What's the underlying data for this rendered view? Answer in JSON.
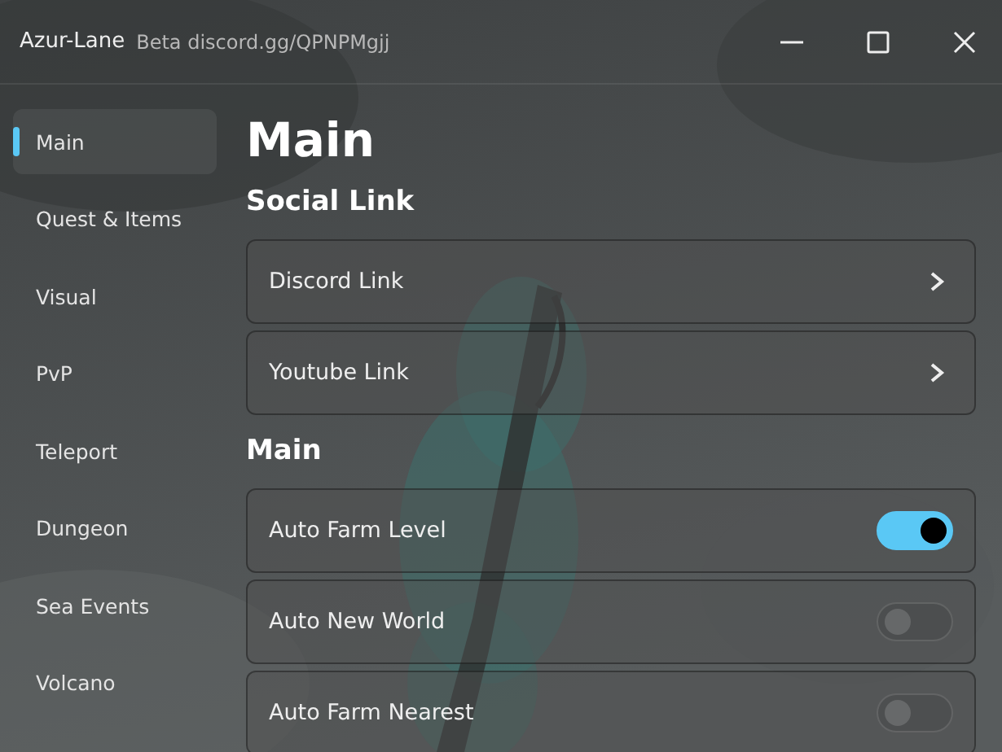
{
  "window": {
    "title": "Azur-Lane",
    "subtitle": "Beta discord.gg/QPNPMgjj"
  },
  "sidebar": {
    "items": [
      {
        "label": "Main",
        "selected": true
      },
      {
        "label": "Quest & Items",
        "selected": false
      },
      {
        "label": "Visual",
        "selected": false
      },
      {
        "label": "PvP",
        "selected": false
      },
      {
        "label": "Teleport",
        "selected": false
      },
      {
        "label": "Dungeon",
        "selected": false
      },
      {
        "label": "Sea Events",
        "selected": false
      },
      {
        "label": "Volcano",
        "selected": false
      }
    ]
  },
  "page_title": "Main",
  "sections": [
    {
      "title": "Social Link",
      "rows": [
        {
          "kind": "link",
          "label": "Discord Link"
        },
        {
          "kind": "link",
          "label": "Youtube Link"
        }
      ]
    },
    {
      "title": "Main",
      "rows": [
        {
          "kind": "toggle",
          "label": "Auto Farm Level",
          "on": true
        },
        {
          "kind": "toggle",
          "label": "Auto New World",
          "on": false
        },
        {
          "kind": "toggle",
          "label": "Auto Farm Nearest",
          "on": false
        }
      ]
    }
  ]
}
